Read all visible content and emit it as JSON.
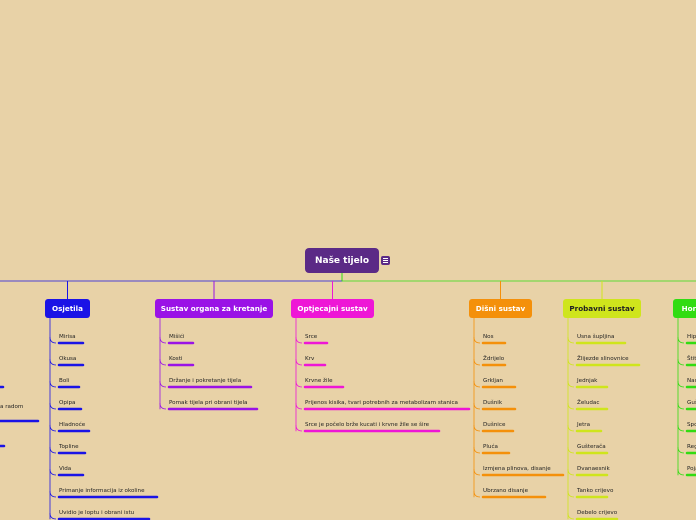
{
  "title": "Naše tijelo",
  "branches": [
    {
      "label": "Osjetila",
      "color": "#1a13e6",
      "items": [
        "Mirisa",
        "Okusa",
        "Boli",
        "Opipa",
        "Hladnoće",
        "Topline",
        "Vida",
        "Primanje informacija iz okoline",
        "Uvidio je loptu i obrani istu"
      ]
    },
    {
      "label": "Sustav organa za kretanje",
      "color": "#9a12e6",
      "items": [
        "Mišići",
        "Kosti",
        "Držanje i pokretanje tijela",
        "Pomak tijela pri obrani tijela"
      ]
    },
    {
      "label": "Optjecajni sustav",
      "color": "#ee16d6",
      "items": [
        "Srce",
        "Krv",
        "Krvne žile",
        "Prijenos kisika,  tvari potrebnih za metabolizam stanica",
        "Srce je počelo brže kucati i krvne žile se šire"
      ]
    },
    {
      "label": "Dišni sustav",
      "color": "#f4900a",
      "items": [
        "Nos",
        "Ždrijelo",
        "Grkljan",
        "Dušnik",
        "Dušnice",
        "Pluća",
        "Izmjena plinova, disanje",
        "Ubrzano disanje"
      ]
    },
    {
      "label": "Probavni sustav",
      "color": "#cfe51c",
      "items": [
        "Usna šupljina",
        "Žlijezde slinovnice",
        "Jednjak",
        "Želudac",
        "Jetra",
        "Gušterača",
        "Dvanaesnik",
        "Tanko crijevo",
        "Debelo crijevo"
      ]
    },
    {
      "label": "Hormonski sustav",
      "color": "#31dc12",
      "items": [
        "Hipofiza",
        "Štitnjača",
        "Nadbubrežne žlijezde",
        "Gušterača",
        "Spolne žlijezde",
        "Regulacija",
        "Pojačano lučenje"
      ]
    }
  ],
  "offscreen_fragment": "a radom"
}
